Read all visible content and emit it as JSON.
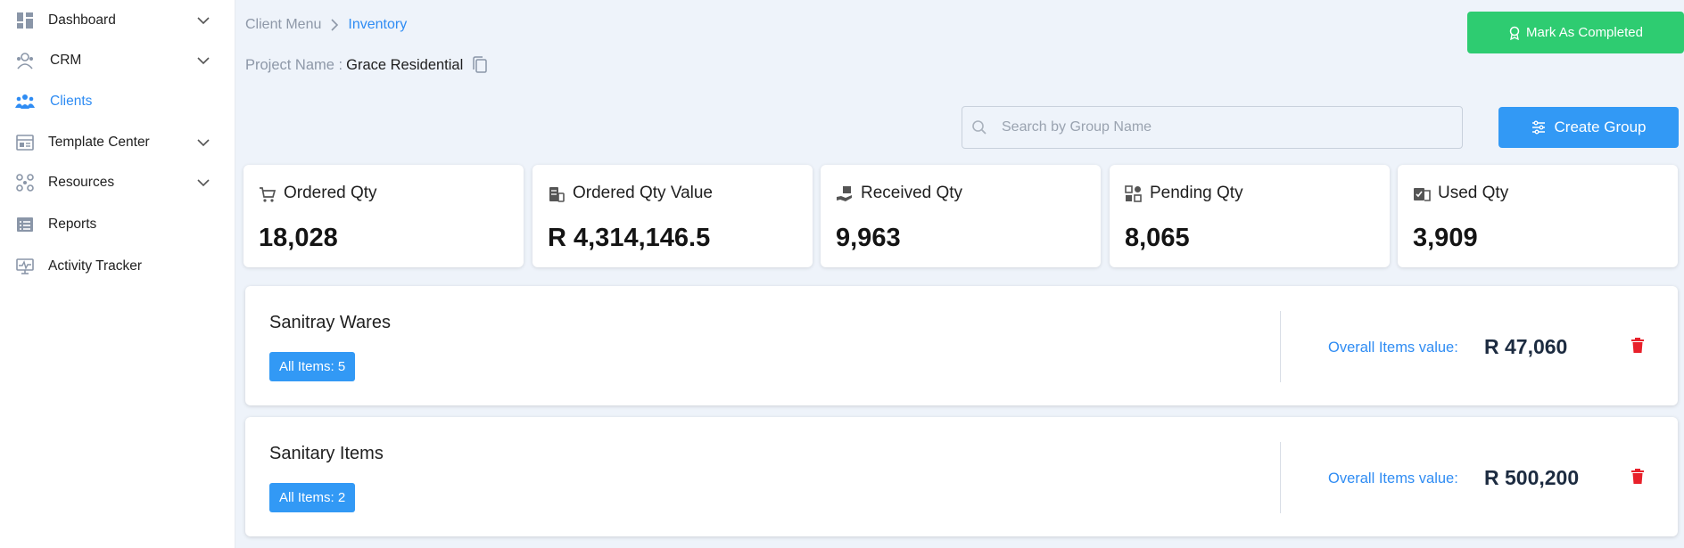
{
  "sidebar": {
    "items": [
      {
        "label": "Dashboard",
        "icon": "dashboard-icon"
      },
      {
        "label": "CRM",
        "icon": "crm-icon"
      },
      {
        "label": "Clients",
        "icon": "clients-icon",
        "active": true
      },
      {
        "label": "Template Center",
        "icon": "template-icon"
      },
      {
        "label": "Resources",
        "icon": "resources-icon"
      },
      {
        "label": "Reports",
        "icon": "reports-icon"
      },
      {
        "label": "Activity Tracker",
        "icon": "activity-icon"
      }
    ]
  },
  "breadcrumb": {
    "parent": "Client Menu",
    "current": "Inventory"
  },
  "project": {
    "label": "Project Name :",
    "name": "Grace Residential"
  },
  "actions": {
    "mark_completed": "Mark As Completed",
    "create_group": "Create Group"
  },
  "search": {
    "placeholder": "Search by Group Name"
  },
  "stats": [
    {
      "label": "Ordered Qty",
      "value": "18,028",
      "icon": "cart-icon"
    },
    {
      "label": "Ordered Qty Value",
      "value": "R 4,314,146.5",
      "icon": "value-icon"
    },
    {
      "label": "Received Qty",
      "value": "9,963",
      "icon": "received-icon"
    },
    {
      "label": "Pending Qty",
      "value": "8,065",
      "icon": "pending-icon"
    },
    {
      "label": "Used Qty",
      "value": "3,909",
      "icon": "used-icon"
    }
  ],
  "groups": [
    {
      "title": "Sanitray Wares",
      "badge": "All Items: 5",
      "value_label": "Overall Items value:",
      "value": "R 47,060"
    },
    {
      "title": "Sanitary Items",
      "badge": "All Items: 2",
      "value_label": "Overall Items value:",
      "value": "R 500,200"
    }
  ],
  "colors": {
    "accent": "#3299f5",
    "success": "#2ecc71",
    "danger": "#e8202a",
    "page_bg": "#eef3fa"
  }
}
